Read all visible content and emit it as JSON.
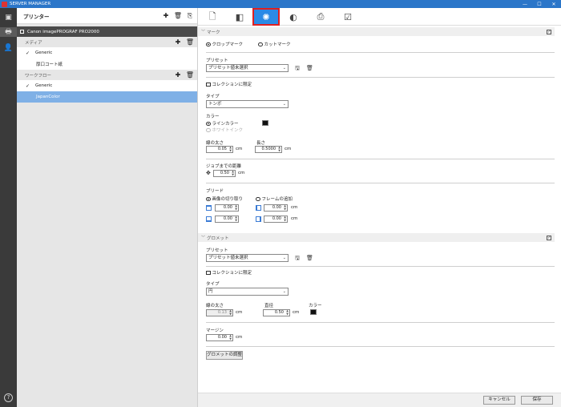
{
  "window": {
    "title": "SERVER MANAGER",
    "controls": [
      "—",
      "☐",
      "✕"
    ]
  },
  "rail": {
    "help": "?"
  },
  "sidebar": {
    "header": "プリンター",
    "printer": "Canon imagePROGRAF PRO2000",
    "media_label": "メディア",
    "media_items": [
      "Generic",
      "厚口コート紙"
    ],
    "workflow_label": "ワークフロー",
    "workflow_items": [
      "Generic",
      "JapanColor"
    ]
  },
  "mark": {
    "section": "マーク",
    "radio_crop": "クロップマーク",
    "radio_cut": "カットマーク",
    "preset_label": "プリセット",
    "preset_value": "プリセット値未選択",
    "collection_limit": "コレクションに限定",
    "type_label": "タイプ",
    "type_value": "トンボ",
    "color_label": "カラー",
    "color_line": "ラインカラー",
    "color_white": "ホワイトインク",
    "line_width_label": "線の太さ",
    "line_width_value": "0.05",
    "length_label": "長さ",
    "length_value": "0.5000",
    "unit": "cm",
    "distance_label": "ジョブまでの距離",
    "distance_value": "0.50",
    "bleed_label": "ブリード",
    "bleed_crop": "画像の切り取り",
    "bleed_frame": "フレームの追加",
    "bleed_top": "0.00",
    "bleed_left": "0.00",
    "bleed_bottom": "0.00",
    "bleed_right": "0.00"
  },
  "grommet": {
    "section": "グロメット",
    "preset_label": "プリセット",
    "preset_value": "プリセット値未選択",
    "collection_limit": "コレクションに限定",
    "type_label": "タイプ",
    "type_value": "円",
    "line_width_label": "線の太さ",
    "line_width_value": "0.13",
    "diameter_label": "直径",
    "diameter_value": "0.50",
    "color_label": "カラー",
    "margin_label": "マージン",
    "margin_value": "0.00",
    "unit": "cm",
    "adjust_button": "グロメットの調整"
  },
  "footer": {
    "cancel": "キャンセル",
    "save": "保存"
  },
  "colors": {
    "accent": "#2b8ae6",
    "titlebar": "#2b76c9",
    "selected": "#7fb0e6",
    "highlight": "#e01f1f"
  }
}
